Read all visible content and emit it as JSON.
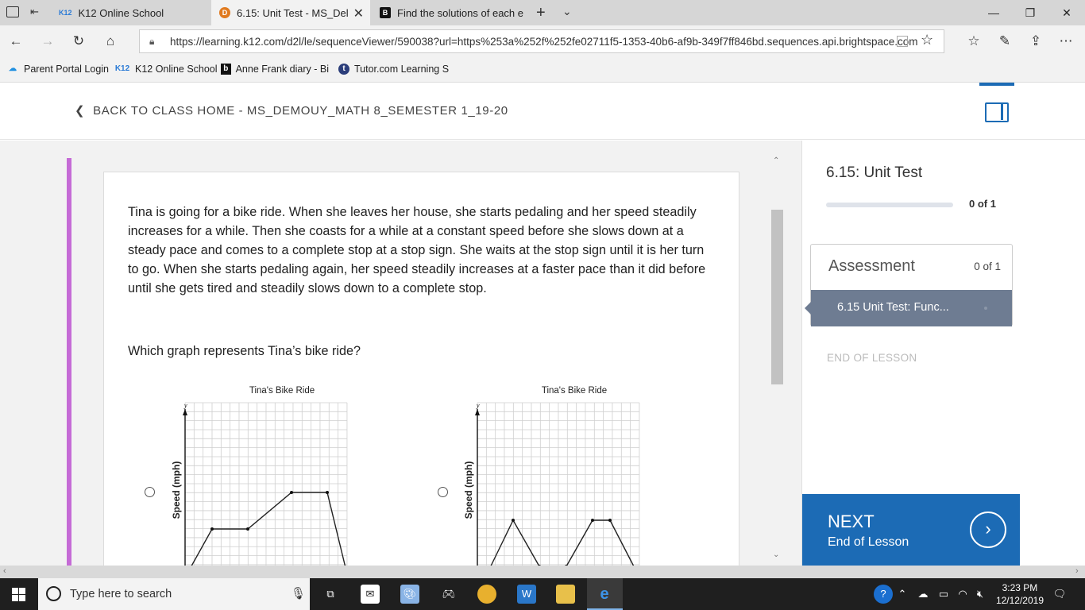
{
  "browser": {
    "tabs": [
      {
        "label": "K12 Online School",
        "favicon": "K12"
      },
      {
        "label": "6.15: Unit Test - MS_Del",
        "favicon": "D"
      },
      {
        "label": "Find the solutions of each e",
        "favicon": "B"
      }
    ],
    "url": "https://learning.k12.com/d2l/le/sequenceViewer/590038?url=https%253a%252f%252fe02711f5-1353-40b6-af9b-349f7ff846bd.sequences.api.brightspace.com",
    "favorites": [
      {
        "label": "Parent Portal Login"
      },
      {
        "label": "K12 Online School"
      },
      {
        "label": "Anne Frank diary - Bi"
      },
      {
        "label": "Tutor.com Learning S"
      }
    ]
  },
  "page": {
    "back_link": "BACK TO CLASS HOME - MS_DEMOUY_MATH 8_SEMESTER 1_19-20",
    "passage": "Tina is going for a bike ride. When she leaves her house, she starts pedaling and her speed steadily increases for a while. Then she coasts for a while at a constant speed before she slows down at a steady pace and comes to a complete stop at a stop sign. She waits at the stop sign until it is her turn to go. When she starts pedaling again, her speed steadily increases at a faster pace than it did before until she gets tired and steadily slows down to a complete stop.",
    "question": "Which graph represents Tina’s bike ride?",
    "graphs": [
      {
        "title": "Tina's Bike Ride",
        "ylabel": "Speed (mph)",
        "axis_y": "y"
      },
      {
        "title": "Tina's Bike Ride",
        "ylabel": "Speed (mph)",
        "axis_y": "y"
      }
    ]
  },
  "sidebar": {
    "title": "6.15: Unit Test",
    "progress_text": "0 of 1",
    "progress_fraction": 0,
    "assessment_label": "Assessment",
    "assessment_count": "0 of 1",
    "assessment_item": "6.15 Unit Test: Func...",
    "end_of_lesson": "END OF LESSON",
    "next_label": "NEXT",
    "next_sub": "End of Lesson"
  },
  "taskbar": {
    "search_placeholder": "Type here to search",
    "time": "3:23 PM",
    "date": "12/12/2019"
  },
  "colors": {
    "accent_purple": "#c56bd6",
    "next_blue": "#1c6bb5",
    "assessment_item_bg": "#6e7c92"
  }
}
